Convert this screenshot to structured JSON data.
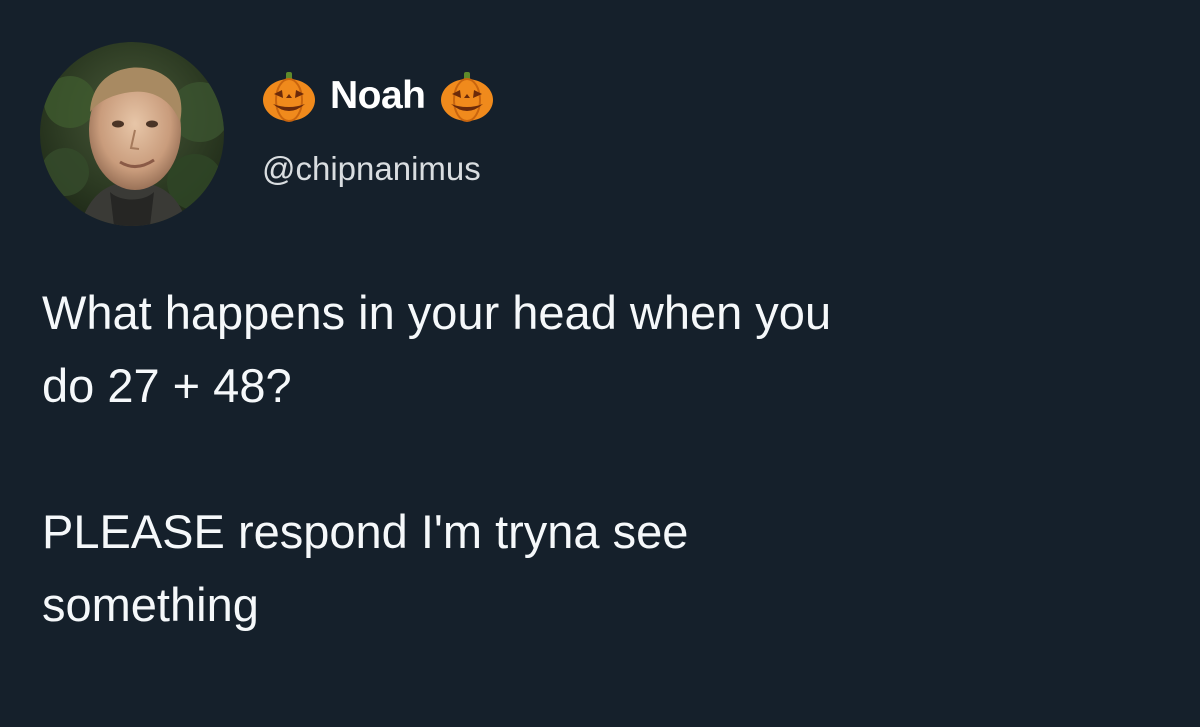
{
  "author": {
    "display_name": "Noah",
    "handle": "@chipnanimus",
    "name_prefix_icon": "jack-o-lantern-icon",
    "name_suffix_icon": "jack-o-lantern-icon"
  },
  "tweet": {
    "line1": "What happens in your head when you",
    "line2": "do 27 + 48?",
    "line3": "PLEASE respond I'm tryna see",
    "line4": "something"
  },
  "colors": {
    "background": "#15202b",
    "text": "#ffffff",
    "handle": "#d9dde0",
    "pumpkin": "#f08a1c"
  }
}
